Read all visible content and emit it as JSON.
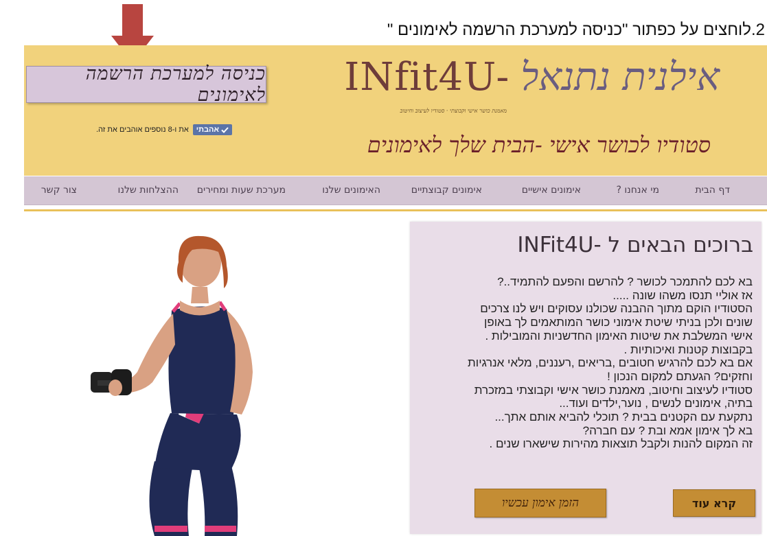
{
  "instruction": "2.לוחצים על כפתור \"כניסה למערכת הרשמה לאימונים \"",
  "header": {
    "cta_label": "כניסה למערכת הרשמה לאימונים",
    "like_button": "אהבתי",
    "like_text": "את ו-8 נוספים אוהבים את זה.",
    "brand_latin": "INfit4U-",
    "brand_hebrew": "אילנית נתנאל",
    "small_tagline": "מאמנת כושר אישי וקבוצתי · סטודיו לעיצוב וחיטוב",
    "studio_tagline": "סטודיו לכושר אישי -הבית שלך לאימונים"
  },
  "nav": {
    "items": [
      "דף הבית",
      "מי אנחנו ?",
      "אימונים אישיים",
      "אימונים קבוצתיים",
      "האימונים שלנו",
      "מערכת שעות  ומחירים",
      "ההצלחות שלנו",
      "צור קשר"
    ]
  },
  "content": {
    "title": "ברוכים הבאים ל -INFit4U",
    "paragraph_lines": [
      "בא לכם להתמכר לכושר ? להרשם והפעם להתמיד..?",
      "אז אוליי תנסו משהו שונה .....",
      "הסטודיו הוקם מתוך ההבנה שכולנו עסוקים ויש לנו צרכים",
      "שונים  ולכן בניתי שיטת אימוני כושר המותאמים לך באופן",
      "אישי המשלבת את שיטות האימון החדשניות והמובילות .",
      "בקבוצות קטנות ואיכותיות .",
      "אם בא לכם להרגיש חטובים ,בריאים ,רעננים, מלאי אנרגיות",
      "וחזקים?  הגעתם למקום הנכון !",
      "סטודיו לעיצוב וחיטוב, מאמנת כושר אישי וקבוצתי במזכרת",
      "בתיה, אימונים לנשים , נוער,ילדים ועוד...",
      "נתקעת עם הקטנים בבית ? תוכלי להביא אותם אתך...",
      "בא לך אימון אמא ובת ? עם חברה?",
      "זה המקום להנות ולקבל תוצאות מהירות שישארו שנים ."
    ],
    "read_more": "קרא עוד",
    "book_now": "הזמן אימון עכשיו"
  },
  "colors": {
    "header_bg": "#f1d27c",
    "nav_bg": "#d4c6d4",
    "panel_bg": "#e9dde8",
    "button_gold": "#c48d34",
    "arrow_red": "#b84540"
  },
  "icons": {
    "arrow": "down-arrow-icon",
    "like": "checkmark-icon"
  }
}
